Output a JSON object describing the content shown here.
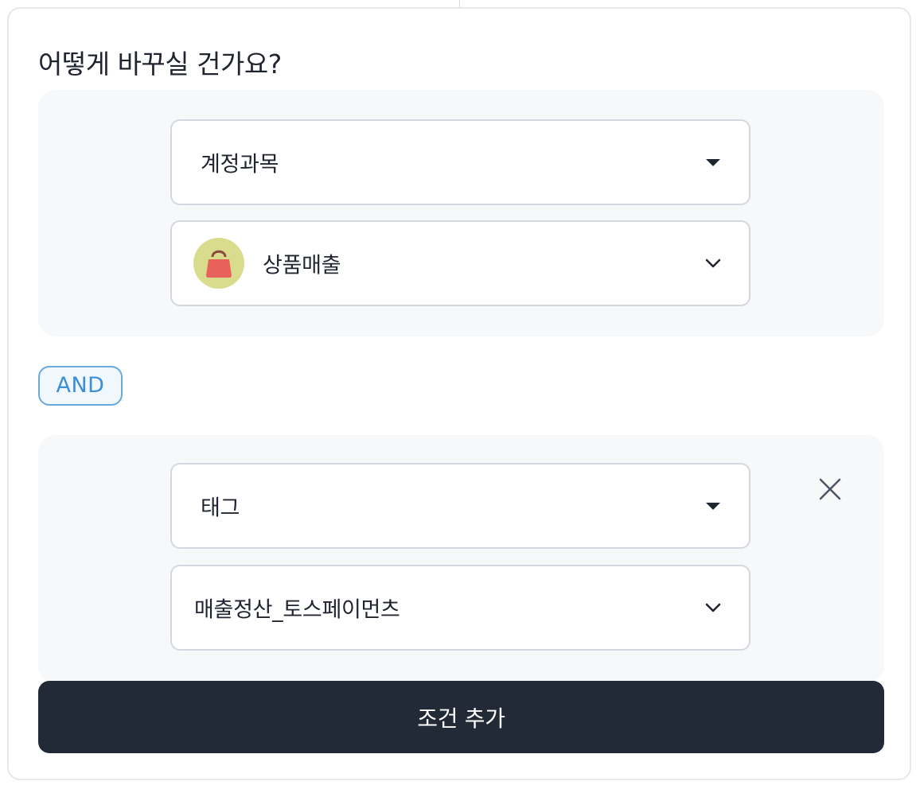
{
  "title": "어떻게 바꾸실 건가요?",
  "conditions": [
    {
      "field": {
        "label": "계정과목",
        "icon": "caret-down-icon"
      },
      "value": {
        "label": "상품매출",
        "avatar_icon": "shopping-bag-icon",
        "avatar_color": "#d9dc8c",
        "icon_color": "#e8615a",
        "icon": "chevron-down-icon"
      }
    },
    {
      "field": {
        "label": "태그",
        "icon": "caret-down-icon"
      },
      "value": {
        "label": "매출정산_토스페이먼츠",
        "icon": "chevron-down-icon"
      },
      "remove_icon": "close-icon"
    }
  ],
  "operator": "AND",
  "add_button_label": "조건 추가",
  "colors": {
    "accent": "#3b8fd6",
    "primary_button": "#222937",
    "group_background": "#f7f8fa"
  }
}
